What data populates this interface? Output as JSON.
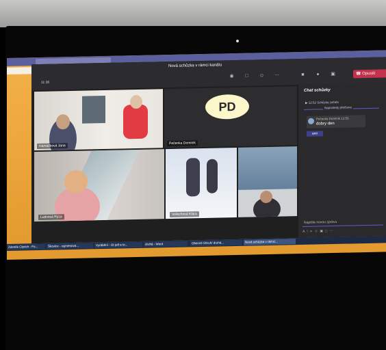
{
  "window": {
    "title": "Nová schůzka v rámci kanálu",
    "elapsed": "11:36",
    "leave_label": "Opustit"
  },
  "participants": [
    {
      "name": "Hamáčková Jana"
    },
    {
      "name": "Pečenka Dominik",
      "initials": "PD"
    },
    {
      "name": "Ludvová Rýza"
    },
    {
      "name": "Vořechová Klára"
    }
  ],
  "chat": {
    "title": "Chat schůzky",
    "system_time": "12:52",
    "system_text": "Schůzka začala",
    "system_sub": "Naposledy přečteno",
    "message": {
      "author": "Pečenka Dominik",
      "time": "12:55",
      "text": "dobry den"
    },
    "reply": "ano",
    "input_placeholder": "Napište novou zprávu"
  },
  "taskbar": {
    "items": [
      "Zdeněk Ciprich - Fo...",
      "Škovice - vyjmenova...",
      "Vyrábění - Ol pdf a to...",
      "druhá - Word",
      "Obecné Okruh/ druhá...",
      "Nová schůzka v rámci..."
    ]
  },
  "colors": {
    "accent": "#5b5fc7",
    "leave": "#c4314b",
    "avatar_pd": "#fbf7cb"
  }
}
